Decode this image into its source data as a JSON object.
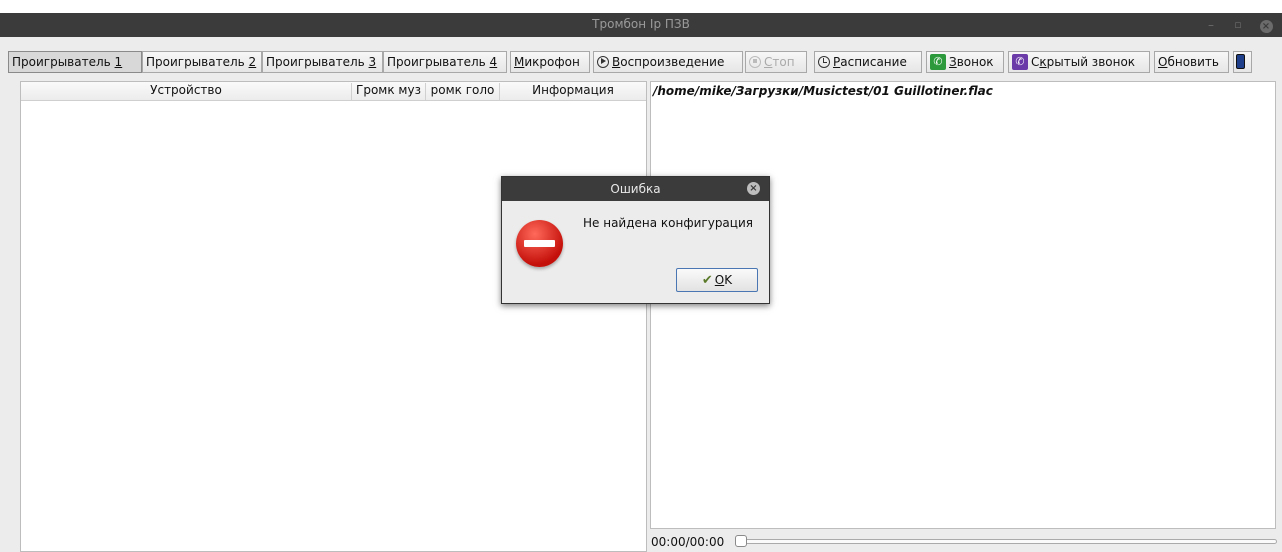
{
  "window": {
    "title": "Тромбон Ip ПЗВ",
    "minimize_glyph": "–",
    "maximize_glyph": "▫",
    "close_glyph": "×"
  },
  "toolbar": {
    "player1": {
      "pre": "Проигрыватель ",
      "key": "1",
      "post": ""
    },
    "player2": {
      "pre": "Проигрыватель ",
      "key": "2",
      "post": ""
    },
    "player3": {
      "pre": "Проигрыватель ",
      "key": "3",
      "post": ""
    },
    "player4": {
      "pre": "Проигрыватель ",
      "key": "4",
      "post": ""
    },
    "mic": {
      "pre": "",
      "key": "М",
      "post": "икрофон"
    },
    "play": {
      "pre": "",
      "key": "В",
      "post": "оспроизведение"
    },
    "stop": {
      "pre": "",
      "key": "С",
      "post": "топ"
    },
    "schedule": {
      "pre": "",
      "key": "Р",
      "post": "асписание"
    },
    "call": {
      "pre": "",
      "key": "З",
      "post": "вонок"
    },
    "hidden_call": {
      "pre": "С",
      "key": "к",
      "post": "рытый звонок"
    },
    "refresh": {
      "pre": "",
      "key": "О",
      "post": "бновить"
    },
    "phone_glyph": "✆"
  },
  "device_table": {
    "columns": [
      "Устройство",
      "Громк муз",
      "ромк голо",
      "Информация"
    ],
    "rows": []
  },
  "player": {
    "file_path": "/home/mike/Загрузки/Musictest/01 Guillotiner.flac",
    "time": "00:00/00:00",
    "progress": 0
  },
  "dialog": {
    "title": "Ошибка",
    "close_glyph": "×",
    "message": "Не найдена конфигурация",
    "ok": {
      "pre": "",
      "key": "O",
      "post": "K"
    },
    "ok_icon": "✔"
  },
  "colors": {
    "titlebar": "#3b3b3b",
    "error_red": "#c4100a",
    "call_green": "#2c9a3c",
    "hidden_call_purple": "#6a3aa8"
  }
}
